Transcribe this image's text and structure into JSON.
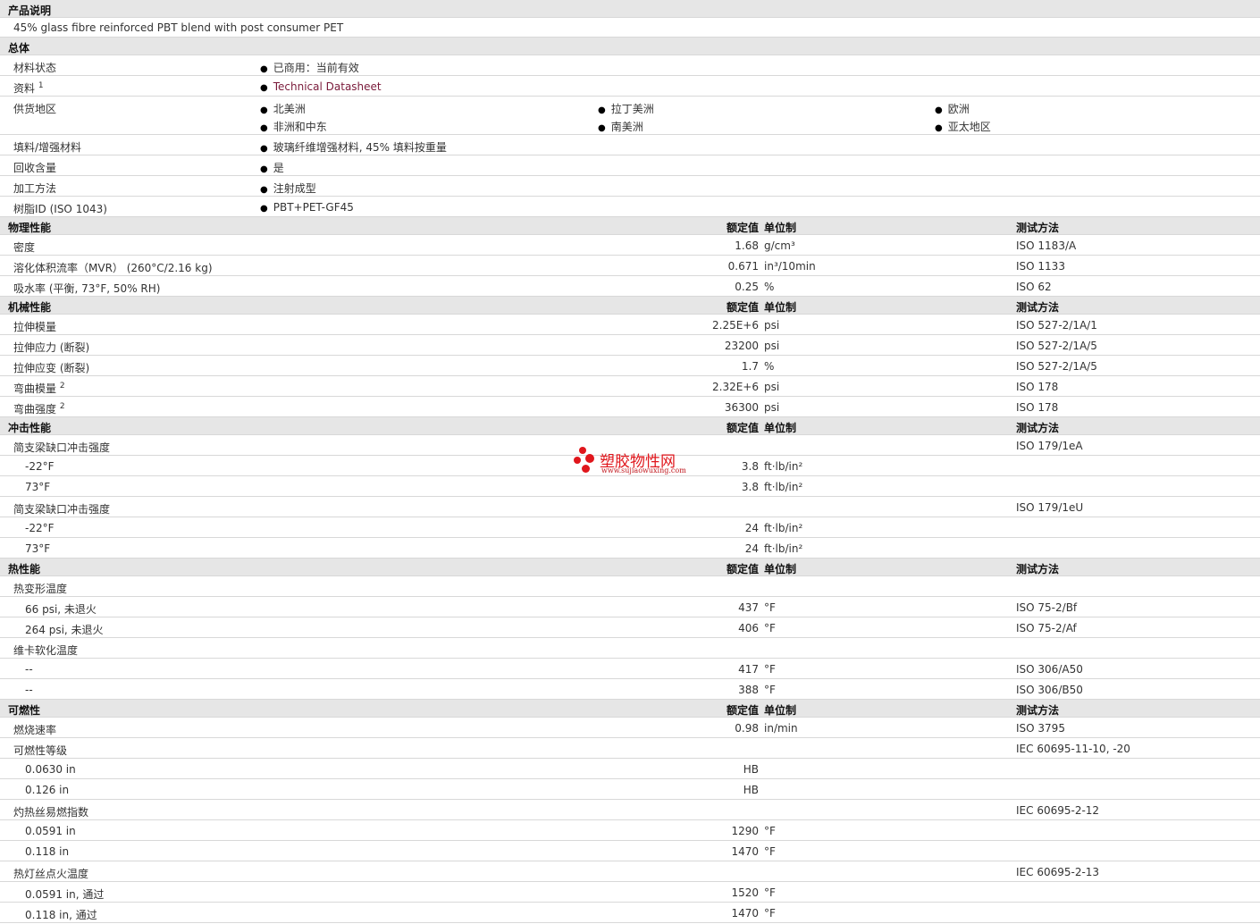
{
  "desc": {
    "title": "产品说明",
    "text": "45% glass fibre reinforced PBT blend with post consumer PET"
  },
  "general": {
    "title": "总体",
    "material_status": {
      "label": "材料状态",
      "value": "已商用：当前有效"
    },
    "docs": {
      "label": "资料",
      "sup": "1",
      "value": "Technical Datasheet"
    },
    "regions": {
      "label": "供货地区",
      "items": [
        "北美洲",
        "拉丁美洲",
        "欧洲",
        "非洲和中东",
        "南美洲",
        "亚太地区"
      ]
    },
    "filler": {
      "label": "填料/增强材料",
      "value": "玻璃纤维增强材料, 45% 填料按重量"
    },
    "recycled": {
      "label": "回收含量",
      "value": "是"
    },
    "processing": {
      "label": "加工方法",
      "value": "注射成型"
    },
    "resin_id": {
      "label": "树脂ID (ISO 1043)",
      "value": "PBT+PET-GF45"
    }
  },
  "headers": {
    "nominal": "额定值",
    "unit": "单位制",
    "method": "测试方法"
  },
  "physical": {
    "title": "物理性能",
    "rows": [
      {
        "label": "密度",
        "value": "1.68",
        "unit": "g/cm³",
        "method": "ISO 1183/A"
      },
      {
        "label": "溶化体积流率（MVR） (260°C/2.16 kg)",
        "value": "0.671",
        "unit": "in³/10min",
        "method": "ISO 1133"
      },
      {
        "label": "吸水率 (平衡, 73°F, 50% RH)",
        "value": "0.25",
        "unit": "%",
        "method": "ISO 62"
      }
    ]
  },
  "mechanical": {
    "title": "机械性能",
    "rows": [
      {
        "label": "拉伸模量",
        "sup": "",
        "value": "2.25E+6",
        "unit": "psi",
        "method": "ISO 527-2/1A/1"
      },
      {
        "label": "拉伸应力 (断裂)",
        "sup": "",
        "value": "23200",
        "unit": "psi",
        "method": "ISO 527-2/1A/5"
      },
      {
        "label": "拉伸应变 (断裂)",
        "sup": "",
        "value": "1.7",
        "unit": "%",
        "method": "ISO 527-2/1A/5"
      },
      {
        "label": "弯曲模量",
        "sup": "2",
        "value": "2.32E+6",
        "unit": "psi",
        "method": "ISO 178"
      },
      {
        "label": "弯曲强度",
        "sup": "2",
        "value": "36300",
        "unit": "psi",
        "method": "ISO 178"
      }
    ]
  },
  "impact": {
    "title": "冲击性能",
    "group1": {
      "label": "简支梁缺口冲击强度",
      "method": "ISO 179/1eA",
      "rows": [
        {
          "label": "-22°F",
          "value": "3.8",
          "unit": "ft·lb/in²"
        },
        {
          "label": "73°F",
          "value": "3.8",
          "unit": "ft·lb/in²"
        }
      ]
    },
    "group2": {
      "label": "简支梁缺口冲击强度",
      "method": "ISO 179/1eU",
      "rows": [
        {
          "label": "-22°F",
          "value": "24",
          "unit": "ft·lb/in²"
        },
        {
          "label": "73°F",
          "value": "24",
          "unit": "ft·lb/in²"
        }
      ]
    }
  },
  "thermal": {
    "title": "热性能",
    "hdt": {
      "label": "热变形温度",
      "rows": [
        {
          "label": "66 psi, 未退火",
          "value": "437",
          "unit": "°F",
          "method": "ISO 75-2/Bf"
        },
        {
          "label": "264 psi, 未退火",
          "value": "406",
          "unit": "°F",
          "method": "ISO 75-2/Af"
        }
      ]
    },
    "vicat": {
      "label": "维卡软化温度",
      "rows": [
        {
          "label": "--",
          "value": "417",
          "unit": "°F",
          "method": "ISO 306/A50"
        },
        {
          "label": "--",
          "value": "388",
          "unit": "°F",
          "method": "ISO 306/B50"
        }
      ]
    }
  },
  "flammability": {
    "title": "可燃性",
    "burn": {
      "label": "燃烧速率",
      "value": "0.98",
      "unit": "in/min",
      "method": "ISO 3795"
    },
    "rating": {
      "label": "可燃性等级",
      "method": "IEC 60695-11-10, -20",
      "rows": [
        {
          "label": "0.0630 in",
          "value": "HB"
        },
        {
          "label": "0.126 in",
          "value": "HB"
        }
      ]
    },
    "gwfi": {
      "label": "灼热丝易燃指数",
      "method": "IEC 60695-2-12",
      "rows": [
        {
          "label": "0.0591 in",
          "value": "1290",
          "unit": "°F"
        },
        {
          "label": "0.118 in",
          "value": "1470",
          "unit": "°F"
        }
      ]
    },
    "gwit": {
      "label": "热灯丝点火温度",
      "method": "IEC 60695-2-13",
      "rows": [
        {
          "label": "0.0591 in, 通过",
          "value": "1520",
          "unit": "°F"
        },
        {
          "label": "0.118 in, 通过",
          "value": "1470",
          "unit": "°F"
        }
      ]
    }
  },
  "watermark": {
    "title": "塑胶物性网",
    "url": "www.sujiaowuxing.com",
    "color": "#e0161c"
  }
}
